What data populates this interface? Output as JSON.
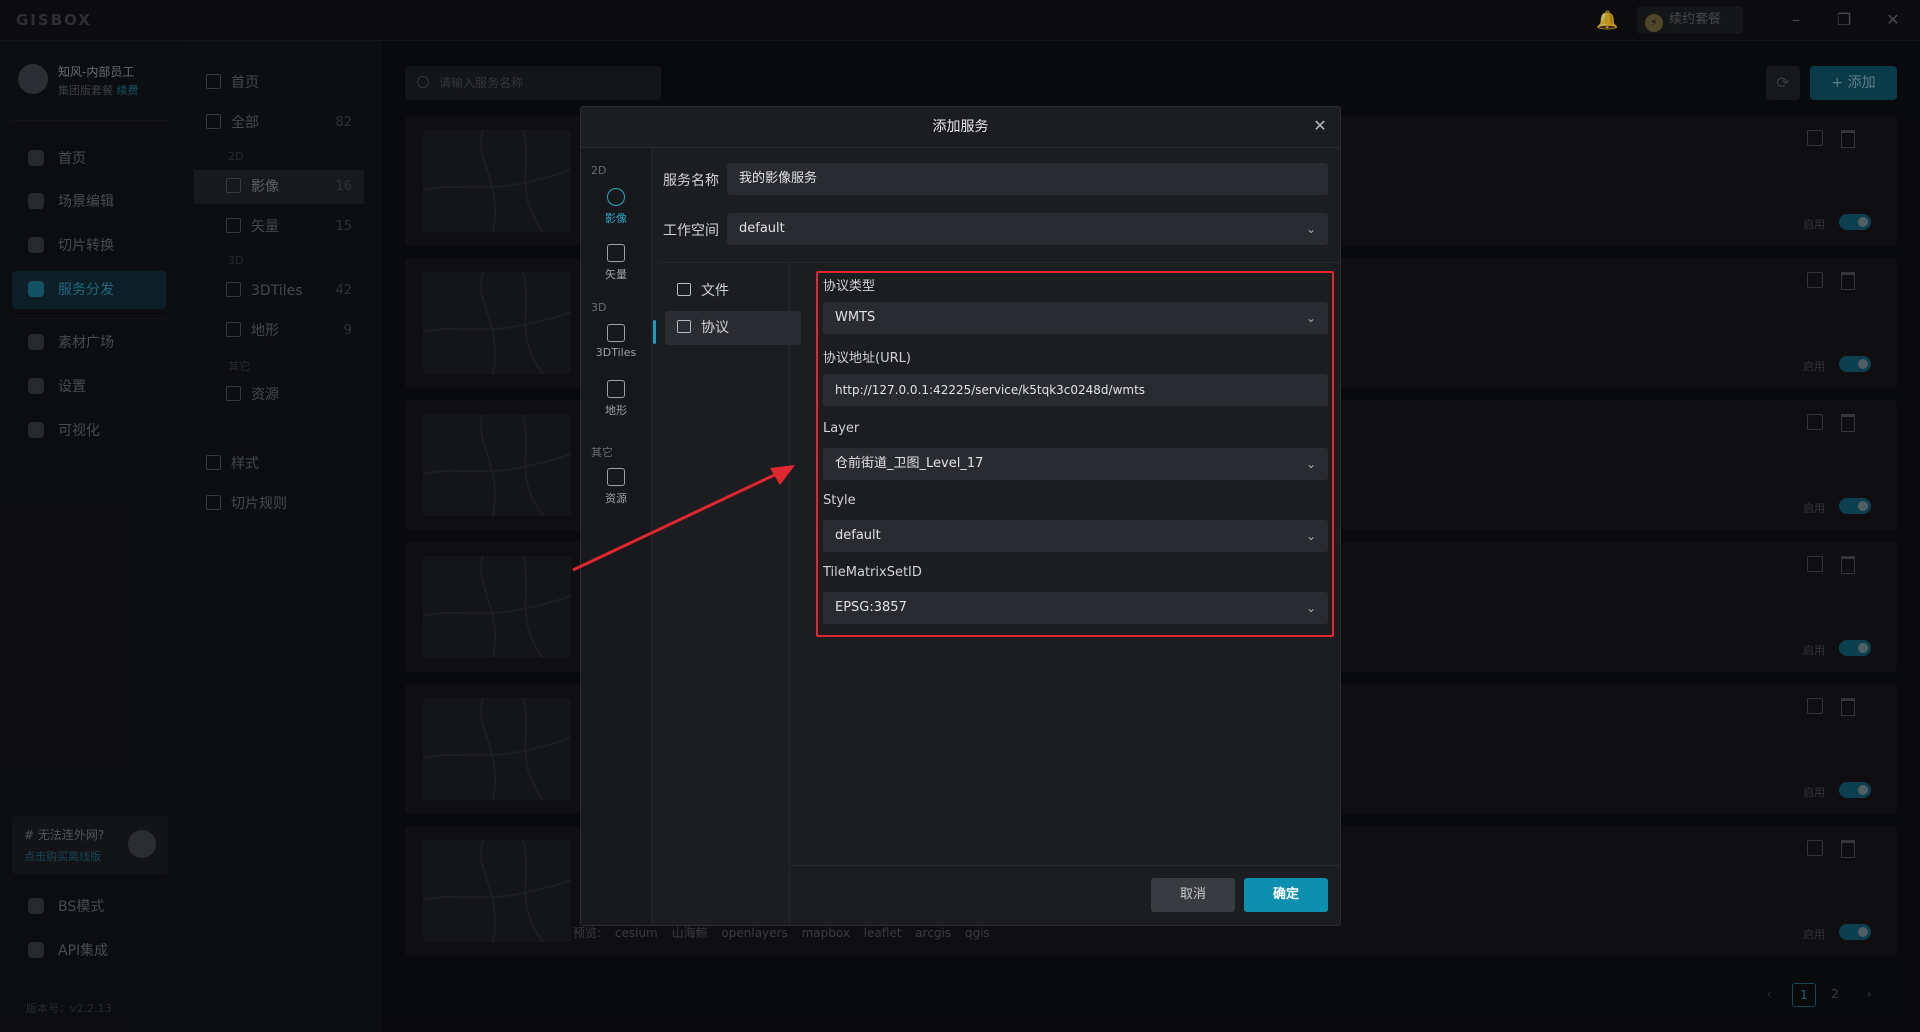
{
  "app": {
    "logo": "GISBOX",
    "renew_label": "续约套餐",
    "minimize": "–",
    "restore": "❐",
    "close": "✕"
  },
  "user": {
    "name": "知风-内部员工",
    "plan": "集团版套餐",
    "renew_link": "续费"
  },
  "leftnav": {
    "items": [
      {
        "label": "首页",
        "icon": "home-icon"
      },
      {
        "label": "场景编辑",
        "icon": "cube-icon"
      },
      {
        "label": "切片转换",
        "icon": "convert-icon"
      },
      {
        "label": "服务分发",
        "icon": "upload-icon",
        "active": true
      },
      {
        "label": "素材广场",
        "icon": "image-icon"
      },
      {
        "label": "设置",
        "icon": "gear-icon"
      },
      {
        "label": "可视化",
        "icon": "chart-icon"
      }
    ],
    "promo": {
      "title": "# 无法连外网?",
      "link": "点击购买离线版"
    },
    "bottom": [
      {
        "label": "BS模式"
      },
      {
        "label": "API集成"
      }
    ],
    "version": "版本号：v2.2.13"
  },
  "catnav": {
    "home": "首页",
    "all": {
      "label": "全部",
      "count": "82"
    },
    "group_2d": "2D",
    "imagery": {
      "label": "影像",
      "count": "16"
    },
    "vector": {
      "label": "矢量",
      "count": "15"
    },
    "group_3d": "3D",
    "tiles3d": {
      "label": "3DTiles",
      "count": "42"
    },
    "terrain": {
      "label": "地形",
      "count": "9"
    },
    "group_other": "其它",
    "resource": {
      "label": "资源"
    },
    "style": "样式",
    "tile_rules": "切片规则"
  },
  "content": {
    "search_placeholder": "请输入服务名称",
    "add_label": "添加",
    "enable_label": "启用",
    "preview_label": "预览:",
    "preview_links": [
      "cesium",
      "山海鲸",
      "openlayers",
      "mapbox",
      "leaflet",
      "arcgis",
      "qgis"
    ],
    "pages": [
      "1",
      "2"
    ]
  },
  "modal": {
    "title": "添加服务",
    "types": {
      "group_2d": "2D",
      "imagery": "影像",
      "vector": "矢量",
      "group_3d": "3D",
      "tiles3d": "3DTiles",
      "terrain": "地形",
      "group_other": "其它",
      "resource": "资源"
    },
    "service_name_label": "服务名称",
    "service_name_value": "我的影像服务",
    "workspace_label": "工作空间",
    "workspace_value": "default",
    "source_tabs": [
      {
        "label": "文件"
      },
      {
        "label": "协议",
        "active": true
      }
    ],
    "protocol_type_label": "协议类型",
    "protocol_type_value": "WMTS",
    "url_label": "协议地址(URL)",
    "url_value": "http://127.0.0.1:42225/service/k5tqk3c0248d/wmts",
    "layer_label": "Layer",
    "layer_value": "仓前街道_卫图_Level_17",
    "style_label": "Style",
    "style_value": "default",
    "tms_label": "TileMatrixSetID",
    "tms_value": "EPSG:3857",
    "cancel": "取消",
    "ok": "确定"
  },
  "colors": {
    "accent": "#0d8fb0",
    "highlight_box": "#e0262e"
  }
}
